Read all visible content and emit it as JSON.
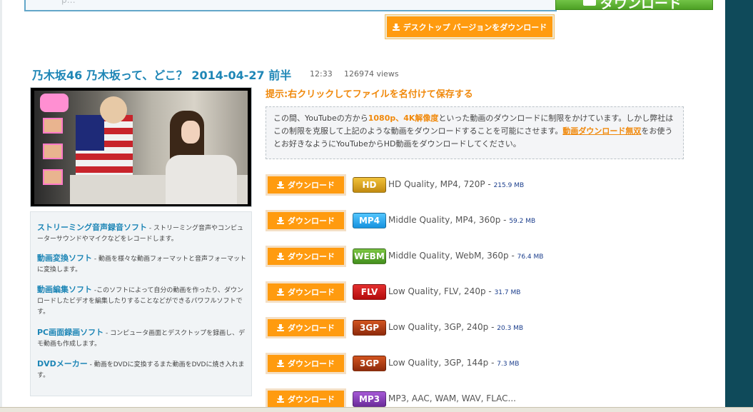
{
  "search": {
    "button_label": "ダウンロード"
  },
  "desktop_button": {
    "label": "デスクトップ バージョンをダウンロード"
  },
  "video": {
    "title": "乃木坂46 乃木坂って、どこ？ 2014-04-27 前半",
    "duration": "12:33",
    "views": "126974 views"
  },
  "sidebar_links": [
    {
      "title": "ストリーミング音声録音ソフト",
      "desc": "- ストリーミング音声やコンピューターサウンドやマイクなどをレコードします。"
    },
    {
      "title": "動画変換ソフト",
      "desc": "- 動画を様々な動画フォーマットと音声フォーマットに変換します。"
    },
    {
      "title": "動画編集ソフト",
      "desc": "-このソフトによって自分の動画を作ったり、ダウンロードしたビデオを編集したりすることなどができるパワフルソフトです。"
    },
    {
      "title": "PC画面録画ソフト",
      "desc": "- コンピュータ画面とデスクトップを録画し、デモ動画も作成します。"
    },
    {
      "title": "DVDメーカー",
      "desc": "- 動画をDVDに変換するまた動画をDVDに焼き入れます。"
    }
  ],
  "hint": "提示:右クリックしてファイルを名付けて保存する",
  "notice": {
    "part1": "この間、YouTubeの方から",
    "highlight1": "1080p、4K解像度",
    "part2": "といった動画のダウンロードに制限をかけています。しかし弊社はこの制限を克服して上記のような動画をダウンロードすることを可能にさせます。",
    "link": "動画ダウンロード無双",
    "part3": "をお使うとお好きなようにYouTubeからHD動画をダウンロードしてください。"
  },
  "download_label": "ダウンロード",
  "downloads": [
    {
      "badge": "HD",
      "badge_color": "#d9a626",
      "desc": "HD Quality, MP4, 720P",
      "size": "215.9 MB"
    },
    {
      "badge": "MP4",
      "badge_color": "#2aa8ee",
      "desc": "Middle Quality, MP4, 360p",
      "size": "59.2 MB"
    },
    {
      "badge": "WEBM",
      "badge_color": "#5aa830",
      "desc": "Middle Quality, WebM, 360p",
      "size": "76.4 MB"
    },
    {
      "badge": "FLV",
      "badge_color": "#cc1d1d",
      "desc": "Low Quality, FLV, 240p",
      "size": "31.7 MB"
    },
    {
      "badge": "3GP",
      "badge_color": "#b04016",
      "desc": "Low Quality, 3GP, 240p",
      "size": "20.3 MB"
    },
    {
      "badge": "3GP",
      "badge_color": "#b04016",
      "desc": "Low Quality, 3GP, 144p",
      "size": "7.3 MB"
    },
    {
      "badge": "MP3",
      "badge_color": "#8a45bb",
      "desc": "MP3, AAC, WAM, WAV, FLAC...",
      "size": ""
    }
  ],
  "colors": {
    "accent_orange": "#ff9b0f",
    "link_blue": "#1e86b6",
    "frame_teal": "#0f4a5a"
  }
}
